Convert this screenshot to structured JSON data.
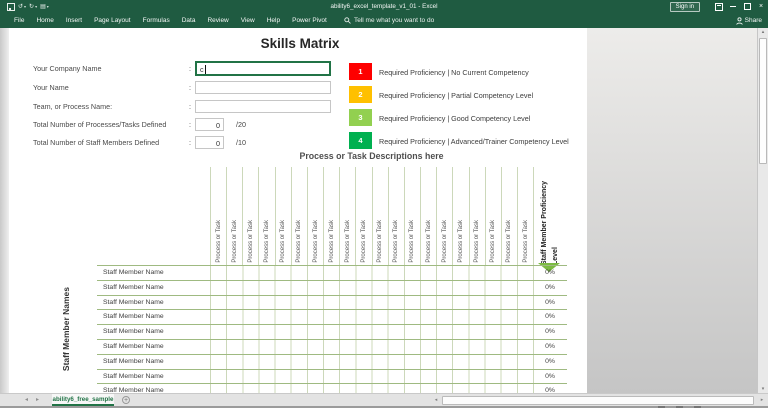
{
  "window": {
    "title": "ability6_excel_template_v1_01 - Excel",
    "sign_in_label": "Sign in"
  },
  "icons": {
    "save": "floppy-disk",
    "undo": "↺",
    "redo": "↻",
    "touch_mode": "▤",
    "dropdown": "▾",
    "close": "×",
    "sheet_prev": "◂",
    "sheet_next": "▸",
    "scroll_up": "▴",
    "scroll_down": "▾",
    "scroll_left": "◂",
    "scroll_right": "▸",
    "add_sheet": "+"
  },
  "ribbon": {
    "tabs": [
      "File",
      "Home",
      "Insert",
      "Page Layout",
      "Formulas",
      "Data",
      "Review",
      "View",
      "Help",
      "Power Pivot"
    ],
    "search_text": "Tell me what you want to do",
    "share_label": "Share"
  },
  "sheet": {
    "title": "Skills Matrix",
    "form": [
      {
        "label": "Your Company Name",
        "sep": ":",
        "value": "c",
        "kind": "text",
        "active": true
      },
      {
        "label": "Your Name",
        "sep": ":",
        "value": "",
        "kind": "text"
      },
      {
        "label": "Team, or Process Name:",
        "sep": ":",
        "value": "",
        "kind": "text"
      },
      {
        "label": "Total Number of Processes/Tasks Defined",
        "sep": ":",
        "value": "0",
        "suffix": "/20",
        "kind": "number"
      },
      {
        "label": "Total Number of Staff Members Defined",
        "sep": ":",
        "value": "0",
        "suffix": "/10",
        "kind": "number"
      }
    ],
    "legend": [
      {
        "level": "1",
        "color": "#FE0000",
        "label": "Required Proficiency | No Current Competency"
      },
      {
        "level": "2",
        "color": "#FFC000",
        "label": "Required Proficiency | Partial Competency Level"
      },
      {
        "level": "3",
        "color": "#92D050",
        "label": "Required Proficiency | Good Competency Level"
      },
      {
        "level": "4",
        "color": "#00B050",
        "label": "Required Proficiency | Advanced/Trainer Competency Level"
      }
    ],
    "matrix": {
      "header": "Process or Task Descriptions here",
      "column_label": "Process or Task",
      "column_count": 20,
      "proficiency_header": "Staff Member Proficiency Level",
      "staff_axis_label": "Staff Member Names",
      "staff_row_label": "Staff Member Name",
      "staff_row_count": 10,
      "proficiency_value": "0%"
    }
  },
  "tab_bar": {
    "active_sheet": "ability6_free_sample"
  },
  "colors": {
    "excel_green": "#1F5B41",
    "accent_green": "#217346",
    "grid_line": "#ccd8ba",
    "row_line": "#9fba81",
    "triangle": "#7CBB42"
  }
}
